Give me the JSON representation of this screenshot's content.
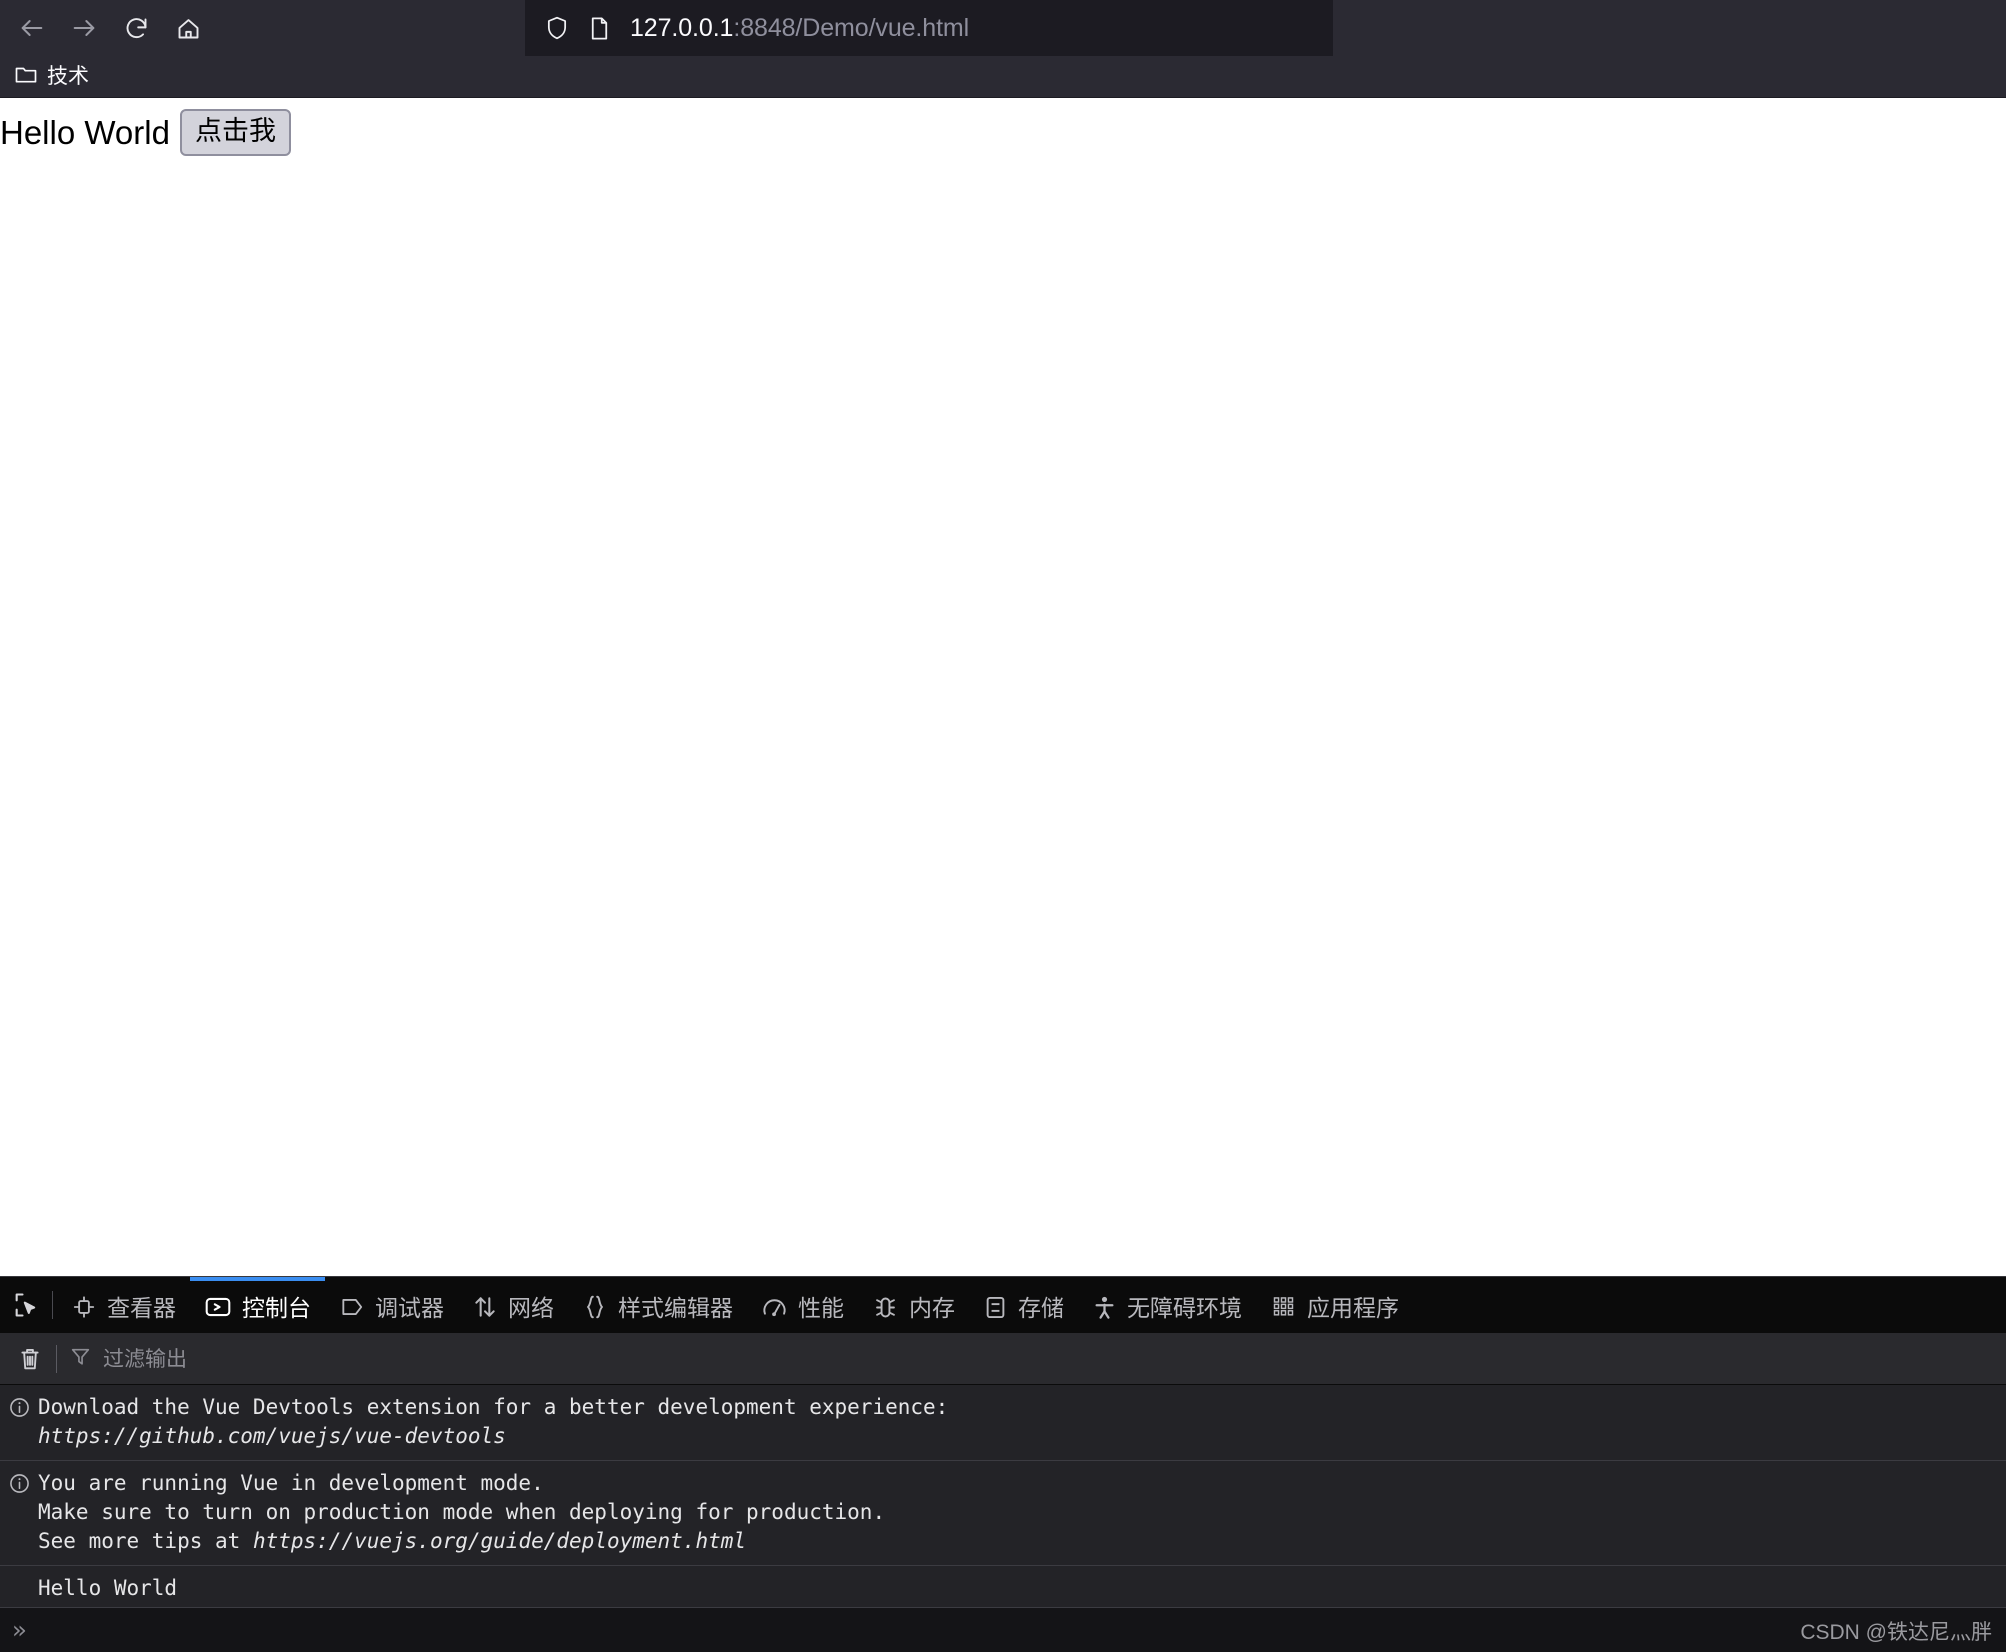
{
  "browser": {
    "nav": {
      "back_label": "Back",
      "forward_label": "Forward",
      "reload_label": "Reload",
      "home_label": "Home"
    },
    "urlbar": {
      "host": "127.0.0.1",
      "path": ":8848/Demo/vue.html",
      "full_url": "127.0.0.1:8848/Demo/vue.html",
      "shield_icon": "shield-icon",
      "page_icon": "page-icon"
    },
    "bookmarks": [
      {
        "label": "技术",
        "icon": "folder-icon"
      }
    ]
  },
  "page": {
    "greeting": "Hello World",
    "button_label": "点击我"
  },
  "devtools": {
    "picker_icon": "element-picker-icon",
    "tabs": [
      {
        "id": "inspector",
        "label": "查看器",
        "icon": "inspector-icon",
        "active": false
      },
      {
        "id": "console",
        "label": "控制台",
        "icon": "console-icon",
        "active": true
      },
      {
        "id": "debugger",
        "label": "调试器",
        "icon": "debugger-icon",
        "active": false
      },
      {
        "id": "network",
        "label": "网络",
        "icon": "network-icon",
        "active": false
      },
      {
        "id": "style",
        "label": "样式编辑器",
        "icon": "style-editor-icon",
        "active": false
      },
      {
        "id": "performance",
        "label": "性能",
        "icon": "performance-icon",
        "active": false
      },
      {
        "id": "memory",
        "label": "内存",
        "icon": "memory-icon",
        "active": false
      },
      {
        "id": "storage",
        "label": "存储",
        "icon": "storage-icon",
        "active": false
      },
      {
        "id": "accessibility",
        "label": "无障碍环境",
        "icon": "accessibility-icon",
        "active": false
      },
      {
        "id": "application",
        "label": "应用程序",
        "icon": "application-icon",
        "active": false
      }
    ],
    "filterbar": {
      "clear_icon": "trash-icon",
      "filter_icon": "funnel-icon",
      "filter_placeholder": "过滤输出"
    },
    "console_rows": [
      {
        "type": "info",
        "icon": "info-icon",
        "lines": [
          "Download the Vue Devtools extension for a better development experience:",
          "https://github.com/vuejs/vue-devtools"
        ],
        "italic_lines": [
          1
        ]
      },
      {
        "type": "info",
        "icon": "info-icon",
        "lines": [
          "You are running Vue in development mode.",
          "Make sure to turn on production mode when deploying for production.",
          "See more tips at https://vuejs.org/guide/deployment.html"
        ],
        "italic_lines": [],
        "italic_tail": {
          "line": 2,
          "prefix": "See more tips at ",
          "link": "https://vuejs.org/guide/deployment.html"
        }
      },
      {
        "type": "log",
        "icon": "none",
        "lines": [
          "Hello World"
        ],
        "italic_lines": []
      }
    ],
    "prompt": {
      "chevrons": "»"
    }
  },
  "watermark": "CSDN @铁达尼灬胖",
  "colors": {
    "chrome_bg": "#2b2a33",
    "urlbar_bg": "#1c1b22",
    "devtools_bg": "#0b0b0b",
    "console_bg": "#232327",
    "accent_blue": "#3a8df0",
    "text_light": "#fbfbfe",
    "text_dim": "#8f8f9d",
    "button_bg": "#d3d3db"
  }
}
